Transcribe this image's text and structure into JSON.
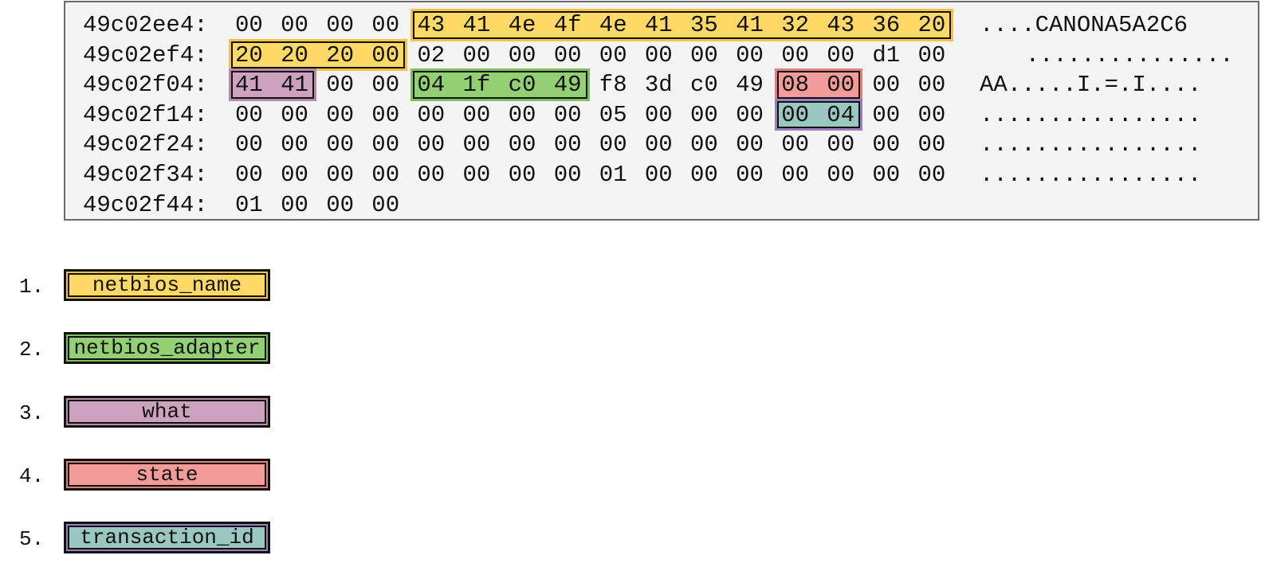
{
  "hexdump": {
    "rows": [
      {
        "address": "49c02ee4:",
        "bytes": [
          "00",
          "00",
          "00",
          "00",
          "43",
          "41",
          "4e",
          "4f",
          "4e",
          "41",
          "35",
          "41",
          "32",
          "43",
          "36",
          "20"
        ],
        "ascii": "....CANONA5A2C6",
        "ascii_offset": 0
      },
      {
        "address": "49c02ef4:",
        "bytes": [
          "20",
          "20",
          "20",
          "00",
          "02",
          "00",
          "00",
          "00",
          "00",
          "00",
          "00",
          "00",
          "00",
          "00",
          "d1",
          "00"
        ],
        "ascii": "...............",
        "ascii_offset": 1
      },
      {
        "address": "49c02f04:",
        "bytes": [
          "41",
          "41",
          "00",
          "00",
          "04",
          "1f",
          "c0",
          "49",
          "f8",
          "3d",
          "c0",
          "49",
          "08",
          "00",
          "00",
          "00"
        ],
        "ascii": "AA.....I.=.I....",
        "ascii_offset": 0
      },
      {
        "address": "49c02f14:",
        "bytes": [
          "00",
          "00",
          "00",
          "00",
          "00",
          "00",
          "00",
          "00",
          "05",
          "00",
          "00",
          "00",
          "00",
          "04",
          "00",
          "00"
        ],
        "ascii": "................",
        "ascii_offset": 0
      },
      {
        "address": "49c02f24:",
        "bytes": [
          "00",
          "00",
          "00",
          "00",
          "00",
          "00",
          "00",
          "00",
          "00",
          "00",
          "00",
          "00",
          "00",
          "00",
          "00",
          "00"
        ],
        "ascii": "................",
        "ascii_offset": 0
      },
      {
        "address": "49c02f34:",
        "bytes": [
          "00",
          "00",
          "00",
          "00",
          "00",
          "00",
          "00",
          "00",
          "01",
          "00",
          "00",
          "00",
          "00",
          "00",
          "00",
          "00"
        ],
        "ascii": "................",
        "ascii_offset": 0
      },
      {
        "address": "49c02f44:",
        "bytes": [
          "01",
          "00",
          "00",
          "00"
        ],
        "ascii": "",
        "ascii_offset": 0
      }
    ],
    "highlights": [
      {
        "field": "netbios_name",
        "row": 0,
        "start": 4,
        "end": 15,
        "color": "netbios_name"
      },
      {
        "field": "netbios_name",
        "row": 1,
        "start": 0,
        "end": 3,
        "color": "netbios_name"
      },
      {
        "field": "what",
        "row": 2,
        "start": 0,
        "end": 1,
        "color": "what"
      },
      {
        "field": "netbios_adapter",
        "row": 2,
        "start": 4,
        "end": 7,
        "color": "netbios_adapter"
      },
      {
        "field": "state",
        "row": 2,
        "start": 12,
        "end": 13,
        "color": "state"
      },
      {
        "field": "transaction_id",
        "row": 3,
        "start": 12,
        "end": 13,
        "color": "transaction_id"
      }
    ]
  },
  "colors": {
    "netbios_name": {
      "fill": "#ffd966",
      "outer": "#f6c344"
    },
    "netbios_adapter": {
      "fill": "#93cf73",
      "outer": "#7fbf5f"
    },
    "what": {
      "fill": "#cda2bf",
      "outer": "#b78aa8"
    },
    "state": {
      "fill": "#f19c99",
      "outer": "#e27f7b"
    },
    "transaction_id": {
      "fill": "#9ac7bf",
      "outer": "#9a7fbc"
    }
  },
  "legend": [
    {
      "number": "1.",
      "label": "netbios_name",
      "color": "netbios_name"
    },
    {
      "number": "2.",
      "label": "netbios_adapter",
      "color": "netbios_adapter"
    },
    {
      "number": "3.",
      "label": "what",
      "color": "what"
    },
    {
      "number": "4.",
      "label": "state",
      "color": "state"
    },
    {
      "number": "5.",
      "label": "transaction_id",
      "color": "transaction_id"
    }
  ]
}
